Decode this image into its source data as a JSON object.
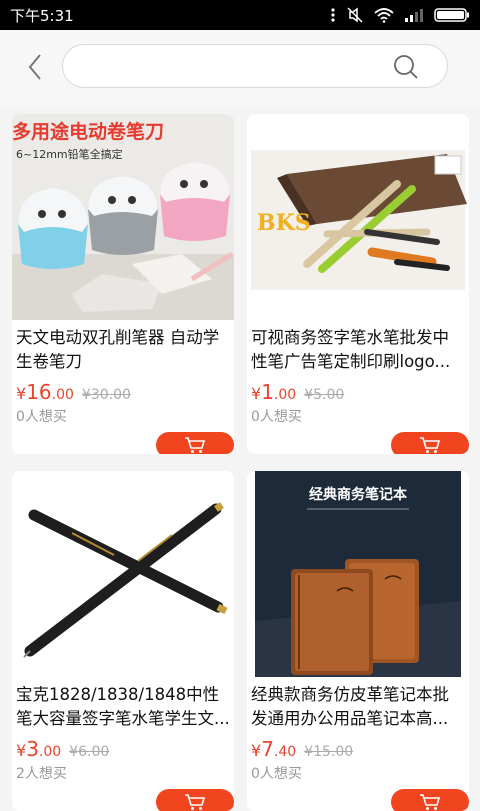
{
  "status_bar": {
    "time": "下午5:31"
  },
  "search": {
    "value": "",
    "placeholder": ""
  },
  "products": [
    {
      "title": "天文电动双孔削笔器 自动学生卷笔刀",
      "currency": "¥",
      "price_int": "16",
      "price_dec": ".00",
      "old_price": "¥30.00",
      "wants": "0人想买",
      "image_text": "多用途电动卷笔刀",
      "image_subtext": "6~12mm铅笔全搞定"
    },
    {
      "title": "可视商务签字笔水笔批发中性笔广告笔定制印刷logo...",
      "currency": "¥",
      "price_int": "1",
      "price_dec": ".00",
      "old_price": "¥5.00",
      "wants": "0人想买",
      "image_text": "BKS"
    },
    {
      "title": "宝克1828/1838/1848中性笔大容量签字笔水笔学生文...",
      "currency": "¥",
      "price_int": "3",
      "price_dec": ".00",
      "old_price": "¥6.00",
      "wants": "2人想买"
    },
    {
      "title": "经典款商务仿皮革笔记本批发通用办公用品笔记本高...",
      "currency": "¥",
      "price_int": "7",
      "price_dec": ".40",
      "old_price": "¥15.00",
      "wants": "0人想买",
      "image_text": "经典商务笔记本"
    }
  ],
  "colors": {
    "accent": "#f0451e",
    "price": "#e8452e"
  }
}
